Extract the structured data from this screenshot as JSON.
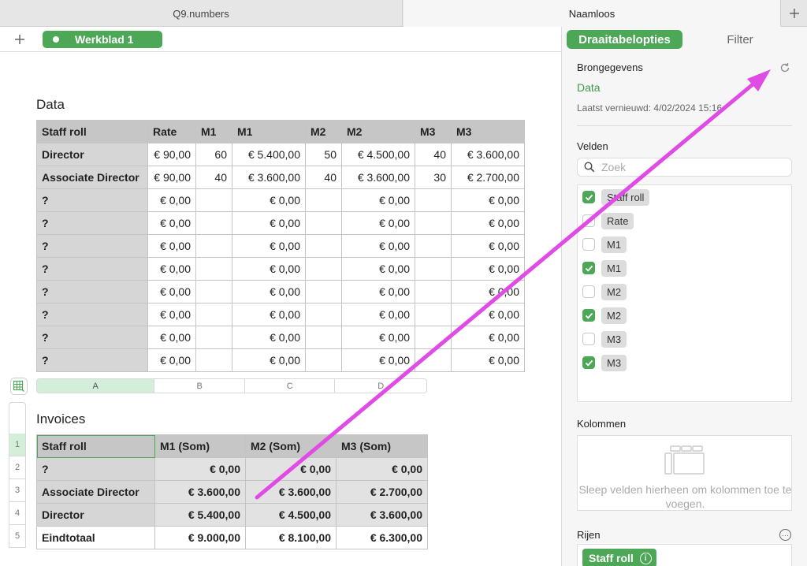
{
  "tabs": [
    {
      "label": "Q9.numbers"
    },
    {
      "label": "Naamloos"
    }
  ],
  "sheet": {
    "label": "Werkblad 1"
  },
  "data_table": {
    "title": "Data",
    "headers": [
      "Staff roll",
      "Rate",
      "M1",
      "M1",
      "M2",
      "M2",
      "M3",
      "M3"
    ],
    "rows": [
      [
        "Director",
        "€ 90,00",
        "60",
        "€ 5.400,00",
        "50",
        "€ 4.500,00",
        "40",
        "€ 3.600,00"
      ],
      [
        "Associate Director",
        "€ 90,00",
        "40",
        "€ 3.600,00",
        "40",
        "€ 3.600,00",
        "30",
        "€ 2.700,00"
      ],
      [
        "?",
        "€ 0,00",
        "",
        "€ 0,00",
        "",
        "€ 0,00",
        "",
        "€ 0,00"
      ],
      [
        "?",
        "€ 0,00",
        "",
        "€ 0,00",
        "",
        "€ 0,00",
        "",
        "€ 0,00"
      ],
      [
        "?",
        "€ 0,00",
        "",
        "€ 0,00",
        "",
        "€ 0,00",
        "",
        "€ 0,00"
      ],
      [
        "?",
        "€ 0,00",
        "",
        "€ 0,00",
        "",
        "€ 0,00",
        "",
        "€ 0,00"
      ],
      [
        "?",
        "€ 0,00",
        "",
        "€ 0,00",
        "",
        "€ 0,00",
        "",
        "€ 0,00"
      ],
      [
        "?",
        "€ 0,00",
        "",
        "€ 0,00",
        "",
        "€ 0,00",
        "",
        "€ 0,00"
      ],
      [
        "?",
        "€ 0,00",
        "",
        "€ 0,00",
        "",
        "€ 0,00",
        "",
        "€ 0,00"
      ],
      [
        "?",
        "€ 0,00",
        "",
        "€ 0,00",
        "",
        "€ 0,00",
        "",
        "€ 0,00"
      ]
    ]
  },
  "column_letters": [
    "A",
    "B",
    "C",
    "D"
  ],
  "row_numbers": [
    "1",
    "2",
    "3",
    "4",
    "5"
  ],
  "pivot_table": {
    "title": "Invoices",
    "headers": [
      "Staff roll",
      "M1 (Som)",
      "M2 (Som)",
      "M3 (Som)"
    ],
    "rows": [
      [
        "?",
        "€ 0,00",
        "€ 0,00",
        "€ 0,00"
      ],
      [
        "Associate Director",
        "€ 3.600,00",
        "€ 3.600,00",
        "€ 2.700,00"
      ],
      [
        "Director",
        "€ 5.400,00",
        "€ 4.500,00",
        "€ 3.600,00"
      ],
      [
        "Eindtotaal",
        "€ 9.000,00",
        "€ 8.100,00",
        "€ 6.300,00"
      ]
    ]
  },
  "panel": {
    "tab_active": "Draaitabelopties",
    "tab_inactive": "Filter",
    "source_label": "Brongegevens",
    "source_value": "Data",
    "last_refreshed": "Laatst vernieuwd: 4/02/2024 15:16",
    "fields_label": "Velden",
    "search_placeholder": "Zoek",
    "fields": [
      {
        "label": "Staff roll",
        "checked": true
      },
      {
        "label": "Rate",
        "checked": false
      },
      {
        "label": "M1",
        "checked": false
      },
      {
        "label": "M1",
        "checked": true
      },
      {
        "label": "M2",
        "checked": false
      },
      {
        "label": "M2",
        "checked": true
      },
      {
        "label": "M3",
        "checked": false
      },
      {
        "label": "M3",
        "checked": true
      }
    ],
    "columns_label": "Kolommen",
    "columns_hint": "Sleep velden hierheen om kolommen toe te voegen.",
    "rows_label": "Rijen",
    "rows_field": "Staff roll",
    "more_glyph": "···",
    "info_glyph": "i"
  },
  "colors": {
    "accent": "#4ca757",
    "annotation_arrow": "#e04be6"
  }
}
